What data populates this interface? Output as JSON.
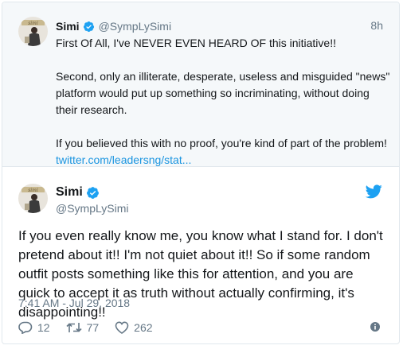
{
  "colors": {
    "link": "#1b95e0",
    "verified": "#1da1f2",
    "muted": "#657786",
    "bg_prev": "#f5f8fa"
  },
  "prev_tweet": {
    "avatar_icon": "avatar-image",
    "name": "Simi",
    "handle": "@SympLySimi",
    "time": "8h",
    "paragraph1": "First Of All, I've NEVER EVEN HEARD OF this initiative!!",
    "paragraph2": "Second, only an illiterate, desperate, useless and misguided \"news\" platform would put up something so incriminating, without doing their research.",
    "paragraph3_text": "If you believed this with no proof, you're kind of part of the problem!",
    "paragraph3_link": "twitter.com/leadersng/stat..."
  },
  "main_tweet": {
    "name": "Simi",
    "handle": "@SympLySimi",
    "text": "If you even really know me, you know what I stand for. I don't pretend about it!! I'm not quiet about it!! So if some random outfit posts something like this for attention, and you are quick to accept it as truth without actually confirming, it's disappointing!!",
    "timestamp": "7:41 AM - Jul 29, 2018",
    "reply_count": "12",
    "retweet_count": "77",
    "like_count": "262",
    "brand_icon": "twitter-bird-icon"
  }
}
